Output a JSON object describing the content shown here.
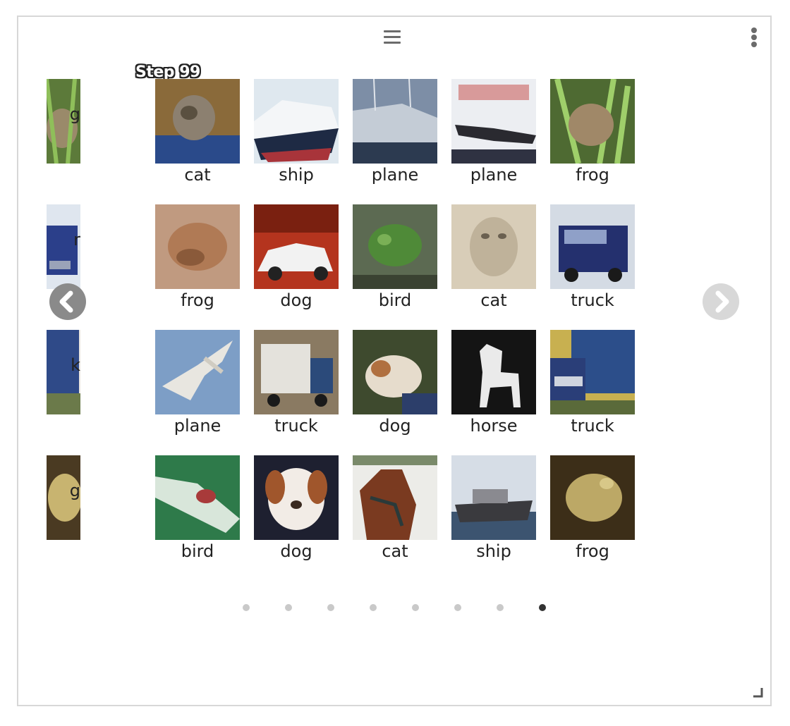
{
  "toolbar": {
    "menu_icon": "hamburger-menu-icon",
    "more_icon": "vertical-ellipsis-icon"
  },
  "step_label": "Step 99",
  "previous_page_captions": [
    "g",
    "r",
    "k",
    "g"
  ],
  "grid": [
    [
      "cat",
      "ship",
      "plane",
      "plane",
      "frog"
    ],
    [
      "frog",
      "dog",
      "bird",
      "cat",
      "truck"
    ],
    [
      "plane",
      "truck",
      "dog",
      "horse",
      "truck"
    ],
    [
      "bird",
      "dog",
      "cat",
      "ship",
      "frog"
    ]
  ],
  "pagination": {
    "total_pages": 8,
    "current_page": 8
  },
  "colors": {
    "dot_inactive": "#c9c9c9",
    "dot_active": "#333333",
    "nav_prev": "#8a8a8a",
    "nav_next": "#d8d8d8"
  }
}
